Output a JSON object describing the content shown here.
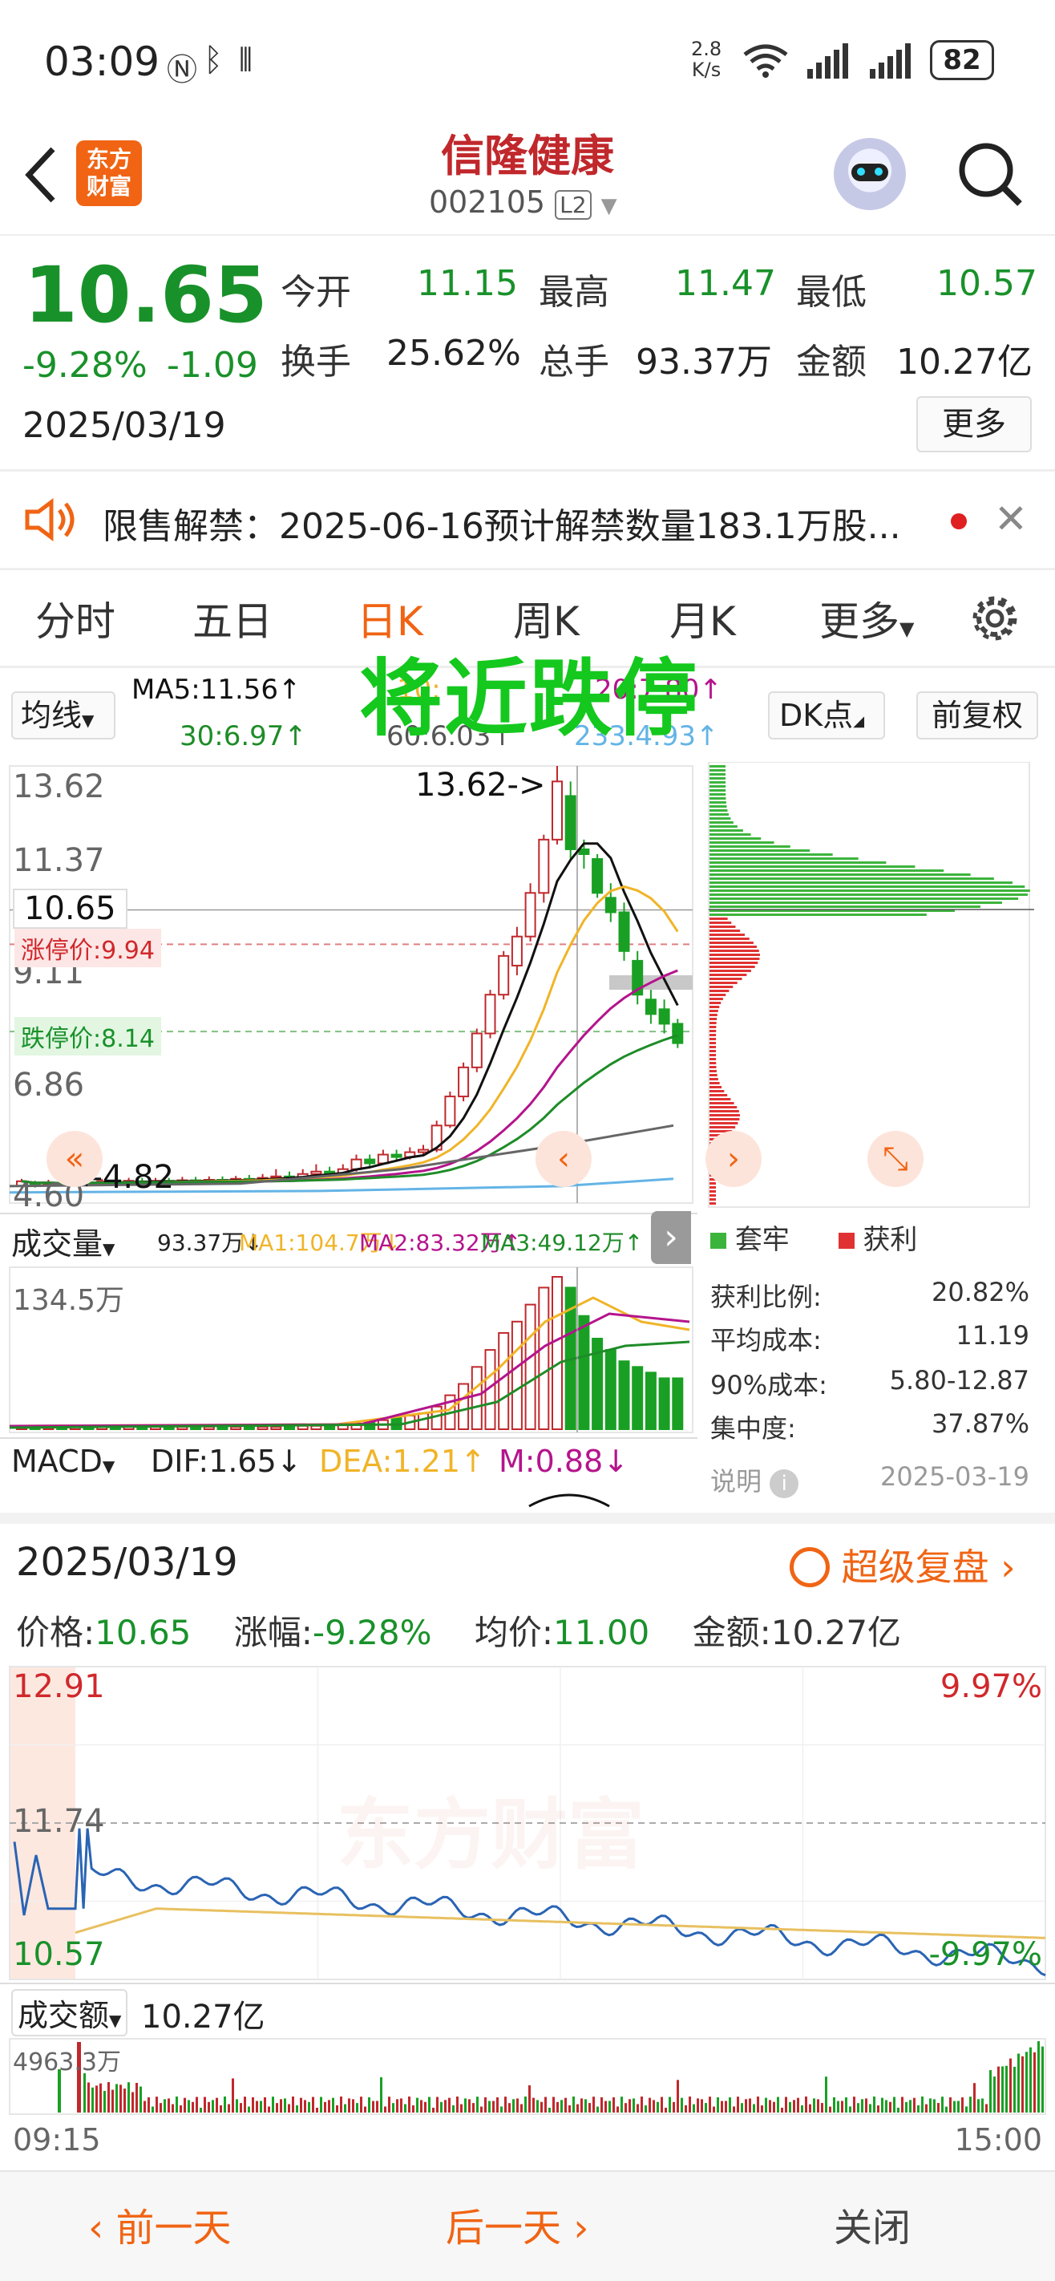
{
  "status_bar": {
    "time": "03:09",
    "net_speed_top": "2.8",
    "net_speed_bottom": "K/s",
    "battery": "82"
  },
  "header": {
    "brand_line1": "东方",
    "brand_line2": "财富",
    "stock_name": "信隆健康",
    "stock_code": "002105",
    "level_badge": "L2"
  },
  "quote": {
    "price": "10.65",
    "change_pct": "-9.28%",
    "change_amt": "-1.09",
    "date": "2025/03/19",
    "open_label": "今开",
    "open": "11.15",
    "high_label": "最高",
    "high": "11.47",
    "low_label": "最低",
    "low": "10.57",
    "turnover_label": "换手",
    "turnover": "25.62%",
    "volume_label": "总手",
    "volume": "93.37万",
    "amount_label": "金额",
    "amount": "10.27亿",
    "more_button": "更多"
  },
  "notice": {
    "text": "限售解禁：2025-06-16预计解禁数量183.1万股..."
  },
  "tabs": [
    "分时",
    "五日",
    "日K",
    "周K",
    "月K",
    "更多"
  ],
  "active_tab": "日K",
  "kline": {
    "overlay_text": "将近跌停",
    "ma_select": "均线",
    "ma5": "MA5:11.56↑",
    "ma10_partial": "10:",
    "ma20": "20:7.80↑",
    "ma30": "30:6.97↑",
    "ma60": "60:6.03↑",
    "ma233": "233:4.93↑",
    "dk_button": "DK点",
    "adjust_button": "前复权",
    "y_labels": [
      "13.62",
      "11.37",
      "9.11",
      "6.86",
      "4.60"
    ],
    "max_marker": "13.62->",
    "min_marker": "<-4.82",
    "current_price_tag": "10.65",
    "limit_up_tag": "涨停价:9.94",
    "limit_down_tag": "跌停价:8.14",
    "volume_select": "成交量",
    "vol": "93.37万↓",
    "vma1": "MA1:104.7万↓",
    "vma2": "MA2:83.32万↑",
    "vma3": "MA3:49.12万↑",
    "vol_max": "134.5万",
    "macd_select": "MACD",
    "dif": "DIF:1.65↓",
    "dea": "DEA:1.21↑",
    "m": "M:0.88↓"
  },
  "chip": {
    "legend_locked": "套牢",
    "legend_profit": "获利",
    "rows": [
      {
        "label": "获利比例:",
        "value": "20.82%"
      },
      {
        "label": "平均成本:",
        "value": "11.19"
      },
      {
        "label": "90%成本:",
        "value": "5.80-12.87"
      },
      {
        "label": "集中度:",
        "value": "37.87%"
      }
    ],
    "explain": "说明",
    "date": "2025-03-19"
  },
  "review": {
    "date": "2025/03/19",
    "super_review": "超级复盘",
    "price_label": "价格:",
    "price": "10.65",
    "change_label": "涨幅:",
    "change": "-9.28%",
    "avg_label": "均价:",
    "avg": "11.00",
    "amount_label": "金额:",
    "amount": "10.27亿",
    "y_top": "12.91",
    "y_mid": "11.74",
    "y_bottom": "10.57",
    "pct_top": "9.97%",
    "pct_bottom": "-9.97%",
    "watermark": "东方财富",
    "amount_select": "成交额",
    "amount_total": "10.27亿",
    "amount_max": "4963.3万",
    "time_start": "09:15",
    "time_end": "15:00"
  },
  "footer": {
    "prev_day": "前一天",
    "next_day": "后一天",
    "close": "关闭"
  },
  "colors": {
    "up": "#d0282c",
    "down": "#19912a",
    "accent_orange": "#f06414",
    "ma5": "#111111",
    "ma10": "#f0b428",
    "ma20": "#b4148c",
    "ma30": "#1e8c28",
    "ma60": "#666666",
    "ma233": "#64b4e6"
  }
}
